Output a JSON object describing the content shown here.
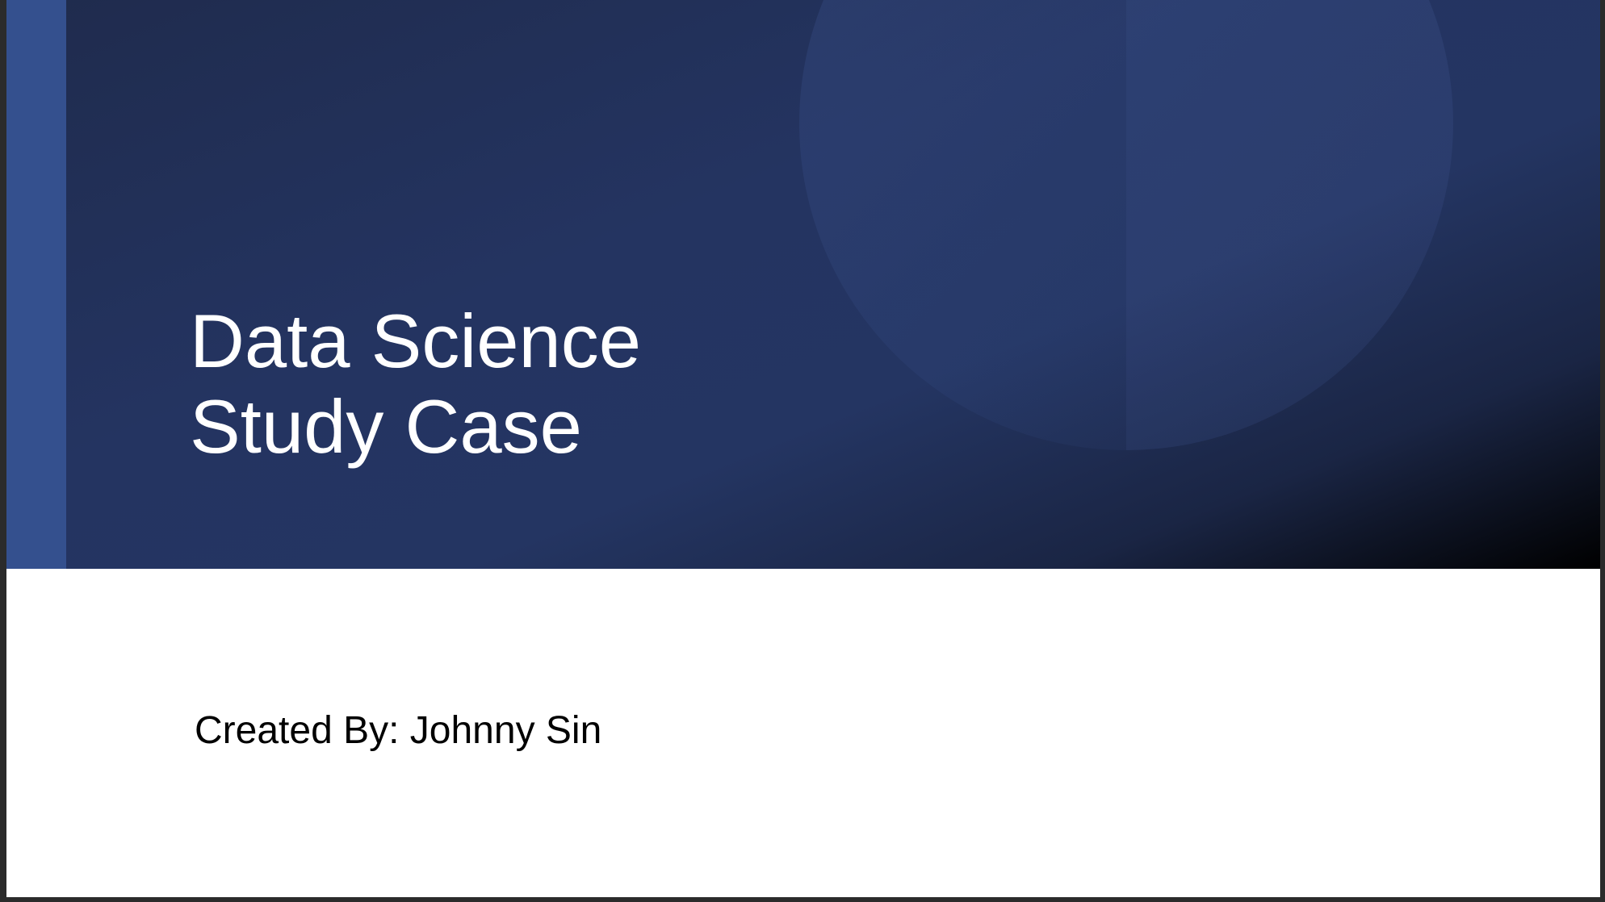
{
  "slide": {
    "title_line_1": "Data Science",
    "title_line_2": "Study Case",
    "subtitle": "Created By: Johnny Sin"
  },
  "colors": {
    "hero_background": "#243461",
    "accent_bar": "#34508e",
    "title_text": "#ffffff",
    "subtitle_text": "#000000"
  }
}
